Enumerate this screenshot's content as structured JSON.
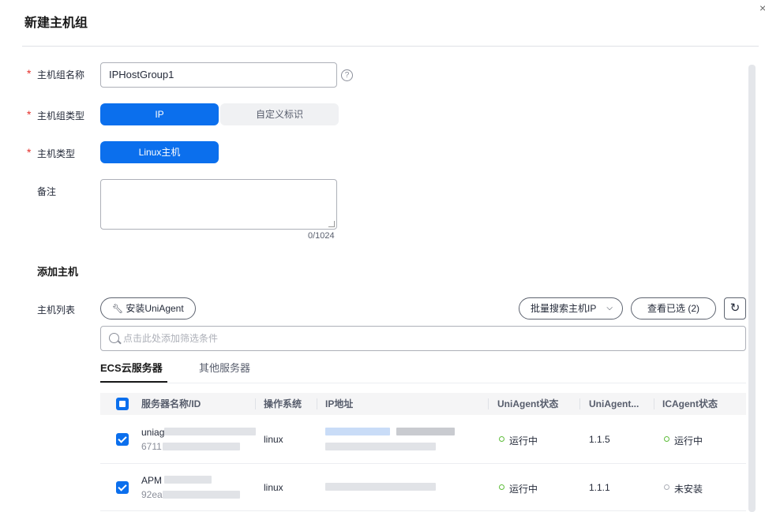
{
  "dialog": {
    "title": "新建主机组",
    "close": "×"
  },
  "form": {
    "group_name": {
      "label": "主机组名称",
      "value": "IPHostGroup1"
    },
    "group_type": {
      "label": "主机组类型",
      "options": [
        "IP",
        "自定义标识"
      ],
      "selected": "IP"
    },
    "host_type": {
      "label": "主机类型",
      "value": "Linux主机"
    },
    "remark": {
      "label": "备注",
      "counter": "0/1024"
    },
    "required_mark": "*"
  },
  "add_host": {
    "section_title": "添加主机",
    "list_label": "主机列表",
    "install_button": "安装UniAgent",
    "batch_search": "批量搜索主机IP",
    "view_selected": "查看已选 (2)",
    "search_placeholder": "点击此处添加筛选条件",
    "tabs": [
      "ECS云服务器",
      "其他服务器"
    ],
    "columns": [
      "服务器名称/ID",
      "操作系统",
      "IP地址",
      "UniAgent状态",
      "UniAgent...",
      "ICAgent状态"
    ],
    "rows": [
      {
        "name_prefix": "uniag",
        "id_prefix": "6711",
        "os": "linux",
        "uniagent_status": "运行中",
        "uniagent_version": "1.1.5",
        "icagent_status": "运行中"
      },
      {
        "name_prefix": "APM",
        "id_prefix": "92ea",
        "os": "linux",
        "uniagent_status": "运行中",
        "uniagent_version": "1.1.1",
        "icagent_status": "未安装"
      }
    ]
  },
  "colors": {
    "primary": "#0b6fed",
    "running": "#5ebd3a",
    "required": "#e5302b"
  }
}
